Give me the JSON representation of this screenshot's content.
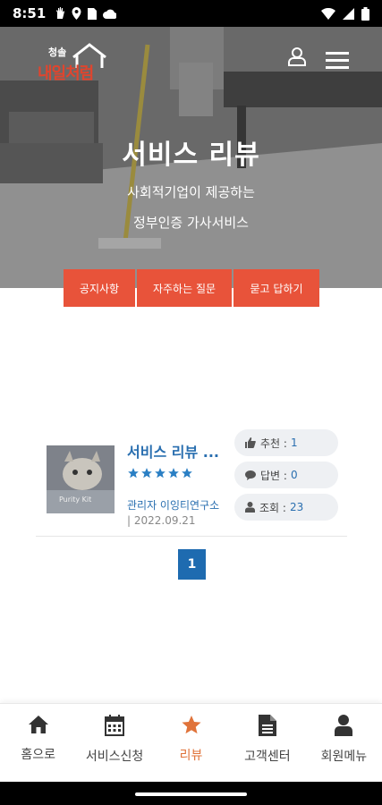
{
  "status_bar": {
    "time": "8:51"
  },
  "header": {
    "logo_top": "청솔",
    "logo_main": "내일처럼"
  },
  "hero": {
    "title": "서비스 리뷰",
    "subtitle_line1": "사회적기업이 제공하는",
    "subtitle_line2": "정부인증 가사서비스"
  },
  "tabs": [
    {
      "label": "공지사항"
    },
    {
      "label": "자주하는 질문"
    },
    {
      "label": "묻고 답하기"
    }
  ],
  "review": {
    "title": "서비스 리뷰 ...",
    "rating": 5,
    "author": "관리자 이잉티연구소",
    "date": "| 2022.09.21",
    "stats": [
      {
        "icon": "thumbs-up-icon",
        "label": "추천 :",
        "value": "1"
      },
      {
        "icon": "comment-icon",
        "label": "답변 :",
        "value": "0"
      },
      {
        "icon": "user-icon",
        "label": "조회 :",
        "value": "23"
      }
    ],
    "thumb_text": "Purity Kit"
  },
  "pagination": {
    "current": "1"
  },
  "bottom_nav": [
    {
      "icon": "home-icon",
      "label": "홈으로"
    },
    {
      "icon": "calendar-icon",
      "label": "서비스신청"
    },
    {
      "icon": "star-icon",
      "label": "리뷰",
      "active": true
    },
    {
      "icon": "document-icon",
      "label": "고객센터"
    },
    {
      "icon": "user-icon",
      "label": "회원메뉴"
    }
  ],
  "colors": {
    "accent": "#e8533a",
    "link": "#2a6fb0",
    "active_nav": "#e0733a"
  }
}
